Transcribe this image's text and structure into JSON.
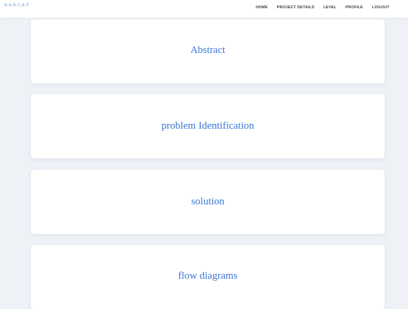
{
  "brand": "N.S.N.C.E.T",
  "nav": {
    "items": [
      {
        "label": "HOME"
      },
      {
        "label": "PROJECT DETAILS"
      },
      {
        "label": "LEVEL"
      },
      {
        "label": "PROFILE"
      },
      {
        "label": "LOGOUT"
      }
    ]
  },
  "cards": [
    {
      "title": "Abstract"
    },
    {
      "title": "problem Identification"
    },
    {
      "title": "solution"
    },
    {
      "title": "flow diagrams"
    }
  ],
  "colors": {
    "background": "#eef2f7",
    "card": "#ffffff",
    "title_blue": "#3a75d6",
    "nav_text": "#3d3d3d"
  }
}
